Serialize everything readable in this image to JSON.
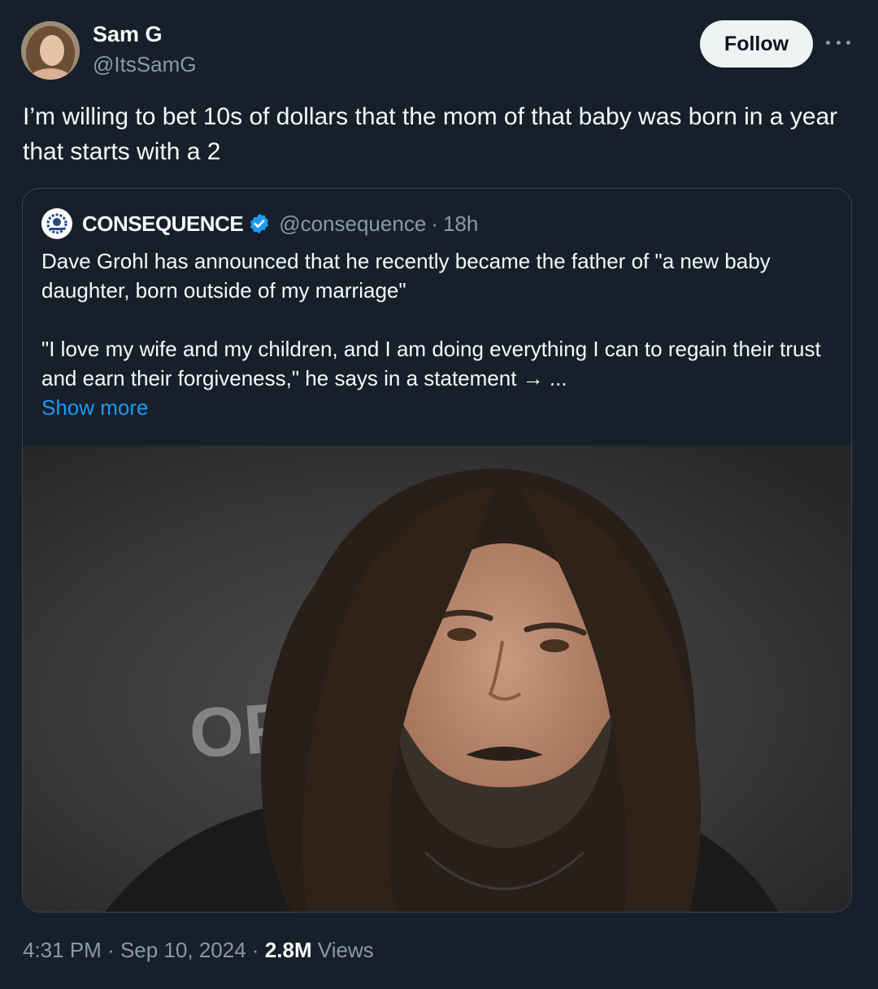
{
  "author": {
    "display_name": "Sam G",
    "handle": "@ItsSamG"
  },
  "follow_label": "Follow",
  "tweet_text": "I’m willing to bet 10s of dollars that the mom of that baby was born in a year that starts with a 2",
  "quote": {
    "name": "CONSEQUENCE",
    "handle": "@consequence",
    "separator": "·",
    "time": "18h",
    "paragraph1": "Dave Grohl has announced that he recently became the father of \"a new baby daughter, born outside of my marriage\"",
    "paragraph2": "\"I love my wife and my children, and I am doing everything I can to regain their trust and earn their forgiveness,\" he says in a statement → ...",
    "show_more": "Show more",
    "backdrop_text": "OPE"
  },
  "meta": {
    "time": "4:31 PM",
    "sep1": "·",
    "date": "Sep 10, 2024",
    "sep2": "·",
    "views_count": "2.8M",
    "views_label": "Views"
  },
  "colors": {
    "background": "#15202b",
    "accent": "#1d9bf0",
    "muted": "#8b98a5"
  }
}
